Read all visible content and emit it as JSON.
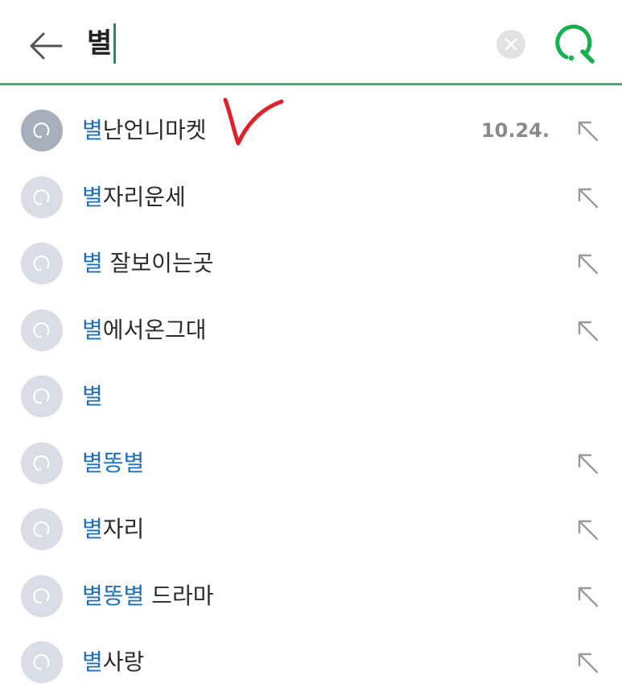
{
  "search": {
    "query": "별",
    "accent_color": "#3cb371",
    "back_icon": "arrow-left-icon",
    "clear_icon": "clear-x-icon",
    "search_icon": "green-search-icon"
  },
  "suggestions": [
    {
      "prefix": "별",
      "rest": "난언니마켓",
      "date": "10.24.",
      "recent": true,
      "fill_arrow": true
    },
    {
      "prefix": "별",
      "rest": "자리운세",
      "date": "",
      "recent": false,
      "fill_arrow": true
    },
    {
      "prefix": "별",
      "rest": " 잘보이는곳",
      "date": "",
      "recent": false,
      "fill_arrow": true
    },
    {
      "prefix": "별",
      "rest": "에서온그대",
      "date": "",
      "recent": false,
      "fill_arrow": true
    },
    {
      "prefix": "별",
      "rest": "",
      "date": "",
      "recent": false,
      "fill_arrow": false
    },
    {
      "prefix": "별똥별",
      "rest": "",
      "date": "",
      "recent": false,
      "fill_arrow": true
    },
    {
      "prefix": "별",
      "rest": "자리",
      "date": "",
      "recent": false,
      "fill_arrow": true
    },
    {
      "prefix": "별똥별",
      "rest": " 드라마",
      "date": "",
      "recent": false,
      "fill_arrow": true
    },
    {
      "prefix": "별",
      "rest": "사랑",
      "date": "",
      "recent": false,
      "fill_arrow": true
    }
  ],
  "colors": {
    "highlight": "#1d6fbe",
    "annotation_mark": "#e0202a"
  }
}
